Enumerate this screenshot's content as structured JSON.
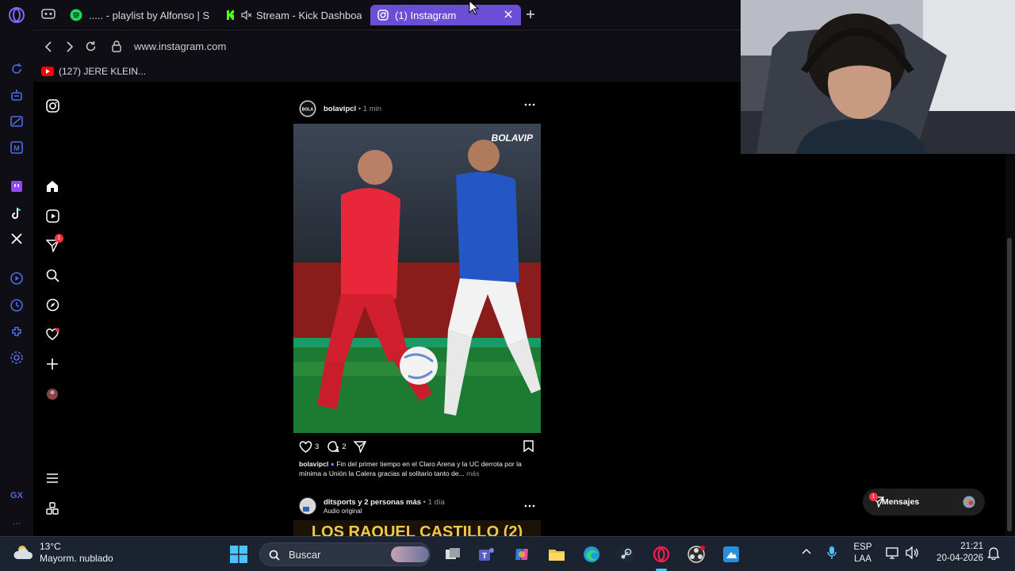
{
  "browser": {
    "tabs": [
      {
        "label": "..... - playlist by Alfonso | S",
        "icon": "spotify-icon",
        "active": false
      },
      {
        "label": "Stream - Kick Dashboa",
        "icon": "kick-icon",
        "active": false
      },
      {
        "label": "(1) Instagram",
        "icon": "instagram-icon",
        "active": true
      }
    ],
    "url": "www.instagram.com",
    "bookmark": "(127) JERE KLEIN..."
  },
  "colors": {
    "accent": "#6a4fd6",
    "notification": "#ff3040",
    "taskbar": "#1c2330"
  },
  "instagram": {
    "nav_badge": "1",
    "post1": {
      "user": "bolavipcl",
      "time": "1 min",
      "likes": "3",
      "comments": "2",
      "image_brand": "BOLAVIP",
      "caption_user": "bolavipcl",
      "caption_text": "Fin del primer tiempo en el Claro Arena y la UC derrota por la mínima a Unión la Calera gracias al solitario tanto de...",
      "more": "más"
    },
    "post2": {
      "user": "dltsports",
      "with": "y 2 personas más",
      "time": "1 día",
      "audio": "Audio original",
      "image_text": "LOS RAQUEL CASTILLO (2)"
    },
    "messages": {
      "label": "Mensajes",
      "badge": "1"
    }
  },
  "taskbar": {
    "weather_temp": "13°C",
    "weather_desc": "Mayorm. nublado",
    "search_placeholder": "Buscar",
    "lang_top": "ESP",
    "lang_bottom": "LAA",
    "time": "21:21",
    "date": "20-04-2026"
  },
  "opera": {
    "gx_label": "GX",
    "more": "..."
  }
}
